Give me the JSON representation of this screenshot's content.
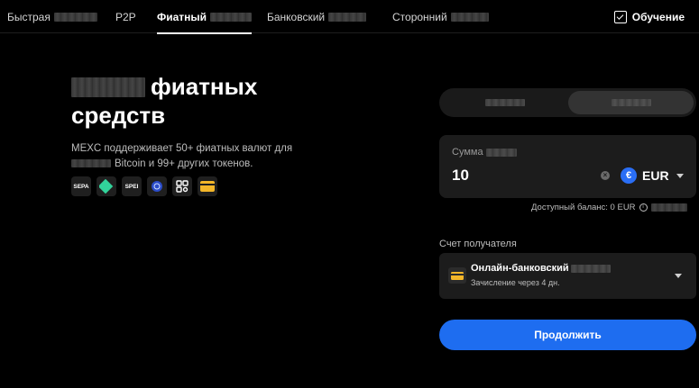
{
  "nav": {
    "tabs": [
      {
        "label": "Быстрая",
        "active": false
      },
      {
        "label": "P2P",
        "active": false
      },
      {
        "label": "Фиатный",
        "active": true
      },
      {
        "label": "Банковский",
        "active": false
      },
      {
        "label": "Сторонний",
        "active": false
      }
    ],
    "learn_label": "Обучение"
  },
  "hero": {
    "title_line1": "фиатных",
    "title_line2": "средств",
    "desc_line1": "MEXC поддерживает 50+ фиатных валют для",
    "desc_line2": "Bitcoin и 99+ других токенов.",
    "payment_methods": [
      {
        "label": "SEPA",
        "icon": "sepa-icon"
      },
      {
        "label": "",
        "icon": "pix-icon"
      },
      {
        "label": "SPEI",
        "icon": "spei-icon"
      },
      {
        "label": "",
        "icon": "coin-icon"
      },
      {
        "label": "",
        "icon": "qr-icon"
      },
      {
        "label": "",
        "icon": "card-icon"
      }
    ]
  },
  "panel": {
    "amount_label": "Сумма",
    "amount_value": "10",
    "currency_code": "EUR",
    "currency_symbol": "€",
    "balance_text": "Доступный баланс: 0 EUR",
    "recipient_label": "Счет получателя",
    "recipient_name": "Онлайн-банковский",
    "recipient_sub": "Зачисление через 4 дн.",
    "continue_label": "Продолжить"
  },
  "colors": {
    "background": "#000000",
    "primary": "#1e6df0",
    "card": "#1c1c1c",
    "accent_card": "#f3b629"
  }
}
